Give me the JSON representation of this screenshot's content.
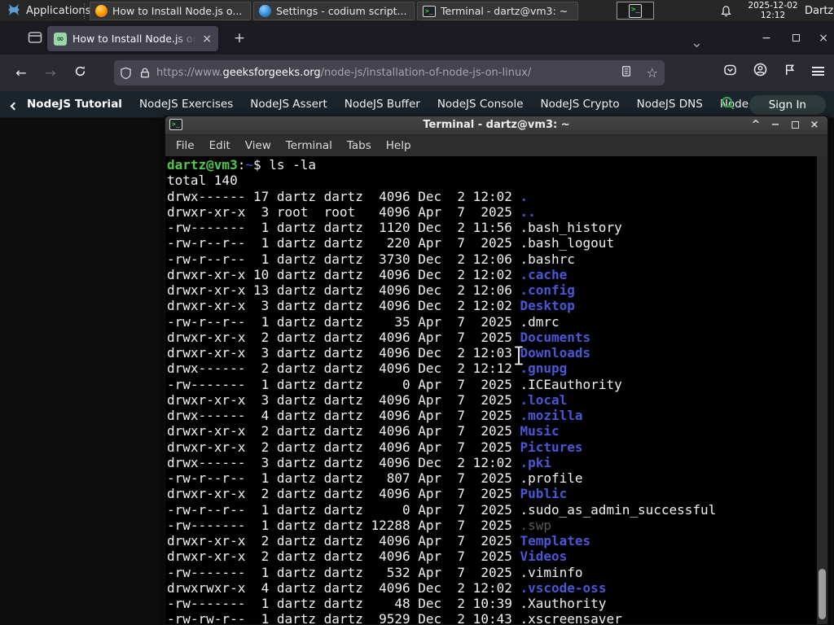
{
  "panel": {
    "applications_label": "Applications",
    "tasks": [
      {
        "icon": "firefox",
        "label": "How to Install Node.js o..."
      },
      {
        "icon": "codium",
        "label": "Settings - codium script..."
      },
      {
        "icon": "terminal",
        "label": "Terminal - dartz@vm3: ~"
      }
    ],
    "clock_date": "2025-12-02",
    "clock_time": "12:12",
    "user": "Dartz"
  },
  "browser": {
    "tab_title": "How to Install Node.js on",
    "favicon_glyph": "∞",
    "url_prefix": "https://www.",
    "url_domain": "geeksforgeeks.org",
    "url_path": "/node-js/installation-of-node-js-on-linux/"
  },
  "site_nav": {
    "current": "NodeJS Tutorial",
    "links": [
      "NodeJS Exercises",
      "NodeJS Assert",
      "NodeJS Buffer",
      "NodeJS Console",
      "NodeJS Crypto",
      "NodeJS DNS",
      "Node"
    ],
    "sign_in": "Sign In"
  },
  "terminal": {
    "title": "Terminal - dartz@vm3: ~",
    "menu": [
      "File",
      "Edit",
      "View",
      "Terminal",
      "Tabs",
      "Help"
    ],
    "lines": [
      [
        [
          "g",
          "dartz@vm3"
        ],
        [
          "w",
          ":"
        ],
        [
          "b",
          "~"
        ],
        [
          "w",
          "$ ls -la"
        ]
      ],
      [
        [
          "w",
          "total 140"
        ]
      ],
      [
        [
          "w",
          "drwx------ 17 dartz dartz  4096 Dec  2 12:02 "
        ],
        [
          "d",
          "."
        ]
      ],
      [
        [
          "w",
          "drwxr-xr-x  3 root  root   4096 Apr  7  2025 "
        ],
        [
          "d",
          ".."
        ]
      ],
      [
        [
          "w",
          "-rw-------  1 dartz dartz  1120 Dec  2 11:56 .bash_history"
        ]
      ],
      [
        [
          "w",
          "-rw-r--r--  1 dartz dartz   220 Apr  7  2025 .bash_logout"
        ]
      ],
      [
        [
          "w",
          "-rw-r--r--  1 dartz dartz  3730 Dec  2 12:06 .bashrc"
        ]
      ],
      [
        [
          "w",
          "drwxr-xr-x 10 dartz dartz  4096 Dec  2 12:02 "
        ],
        [
          "d",
          ".cache"
        ]
      ],
      [
        [
          "w",
          "drwxr-xr-x 13 dartz dartz  4096 Dec  2 12:06 "
        ],
        [
          "d",
          ".config"
        ]
      ],
      [
        [
          "w",
          "drwxr-xr-x  3 dartz dartz  4096 Dec  2 12:02 "
        ],
        [
          "d",
          "Desktop"
        ]
      ],
      [
        [
          "w",
          "-rw-r--r--  1 dartz dartz    35 Apr  7  2025 .dmrc"
        ]
      ],
      [
        [
          "w",
          "drwxr-xr-x  2 dartz dartz  4096 Apr  7  2025 "
        ],
        [
          "d",
          "Documents"
        ]
      ],
      [
        [
          "w",
          "drwxr-xr-x  3 dartz dartz  4096 Dec  2 12:03 "
        ],
        [
          "d",
          "Downloads"
        ]
      ],
      [
        [
          "w",
          "drwx------  2 dartz dartz  4096 Dec  2 12:12 "
        ],
        [
          "d",
          ".gnupg"
        ]
      ],
      [
        [
          "w",
          "-rw-------  1 dartz dartz     0 Apr  7  2025 .ICEauthority"
        ]
      ],
      [
        [
          "w",
          "drwxr-xr-x  3 dartz dartz  4096 Apr  7  2025 "
        ],
        [
          "d",
          ".local"
        ]
      ],
      [
        [
          "w",
          "drwx------  4 dartz dartz  4096 Apr  7  2025 "
        ],
        [
          "d",
          ".mozilla"
        ]
      ],
      [
        [
          "w",
          "drwxr-xr-x  2 dartz dartz  4096 Apr  7  2025 "
        ],
        [
          "d",
          "Music"
        ]
      ],
      [
        [
          "w",
          "drwxr-xr-x  2 dartz dartz  4096 Apr  7  2025 "
        ],
        [
          "d",
          "Pictures"
        ]
      ],
      [
        [
          "w",
          "drwx------  3 dartz dartz  4096 Dec  2 12:02 "
        ],
        [
          "d",
          ".pki"
        ]
      ],
      [
        [
          "w",
          "-rw-r--r--  1 dartz dartz   807 Apr  7  2025 .profile"
        ]
      ],
      [
        [
          "w",
          "drwxr-xr-x  2 dartz dartz  4096 Apr  7  2025 "
        ],
        [
          "d",
          "Public"
        ]
      ],
      [
        [
          "w",
          "-rw-r--r--  1 dartz dartz     0 Apr  7  2025 .sudo_as_admin_successful"
        ]
      ],
      [
        [
          "w",
          "-rw-------  1 dartz dartz 12288 Apr  7  2025 "
        ],
        [
          "dim",
          ".swp"
        ]
      ],
      [
        [
          "w",
          "drwxr-xr-x  2 dartz dartz  4096 Apr  7  2025 "
        ],
        [
          "d",
          "Templates"
        ]
      ],
      [
        [
          "w",
          "drwxr-xr-x  2 dartz dartz  4096 Apr  7  2025 "
        ],
        [
          "d",
          "Videos"
        ]
      ],
      [
        [
          "w",
          "-rw-------  1 dartz dartz   532 Apr  7  2025 .viminfo"
        ]
      ],
      [
        [
          "w",
          "drwxrwxr-x  4 dartz dartz  4096 Dec  2 12:02 "
        ],
        [
          "d",
          ".vscode-oss"
        ]
      ],
      [
        [
          "w",
          "-rw-------  1 dartz dartz    48 Dec  2 10:39 .Xauthority"
        ]
      ],
      [
        [
          "w",
          "-rw-rw-r--  1 dartz dartz  9529 Dec  2 10:43 .xscreensaver"
        ]
      ]
    ]
  },
  "icons": {
    "minimize": "−",
    "close": "×",
    "shade": "^",
    "new_tab": "+",
    "back": "←",
    "forward": "→"
  },
  "colors": {
    "prompt_green": "#4ec94e",
    "dir_blue": "#4a57d4",
    "gfg_green": "#2f8d46",
    "panel_bg": "#272727",
    "tab_active": "#42414d",
    "terminal_bg": "#000000"
  }
}
